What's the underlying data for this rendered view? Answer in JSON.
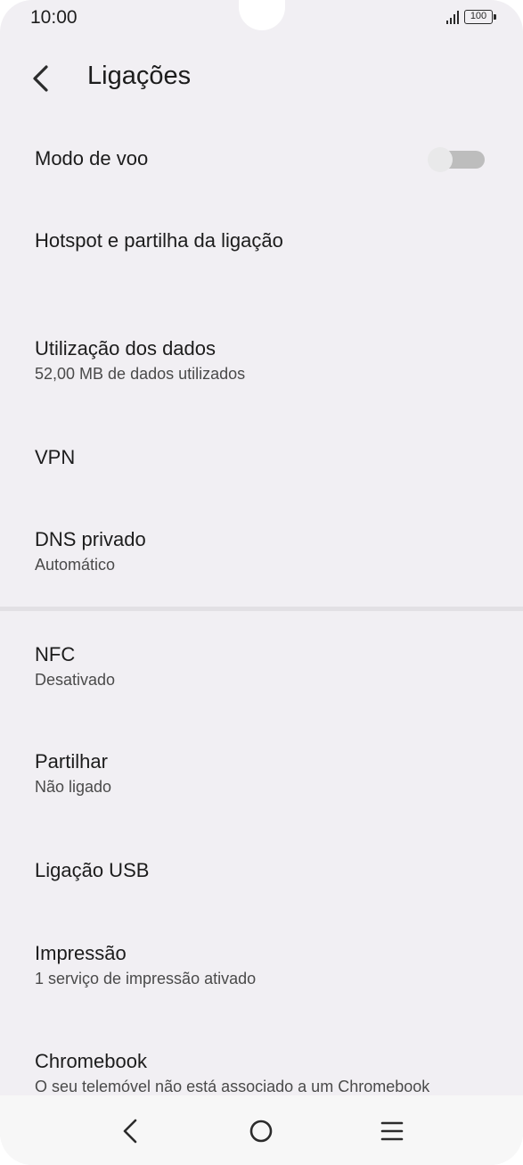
{
  "status_bar": {
    "time": "10:00",
    "battery": "100",
    "icons": [
      "signal-icon",
      "battery-icon"
    ]
  },
  "header": {
    "title": "Ligações",
    "back_icon": "back-arrow-icon"
  },
  "items": [
    {
      "title": "Modo de voo",
      "toggle": false
    },
    {
      "title": "Hotspot e partilha da ligação"
    },
    {
      "title": "Utilização dos dados",
      "subtitle": "52,00 MB de dados utilizados"
    },
    {
      "title": "VPN"
    },
    {
      "title": "DNS privado",
      "subtitle": "Automático"
    },
    {
      "title": "NFC",
      "subtitle": "Desativado"
    },
    {
      "title": "Partilhar",
      "subtitle": "Não ligado"
    },
    {
      "title": "Ligação USB"
    },
    {
      "title": "Impressão",
      "subtitle": "1 serviço de impressão ativado"
    },
    {
      "title": "Chromebook",
      "subtitle": "O seu telemóvel não está associado a um Chromebook"
    }
  ],
  "nav_bar": {
    "icons": [
      "nav-back-icon",
      "nav-home-icon",
      "nav-menu-icon"
    ]
  },
  "colors": {
    "background": "#f1eff3",
    "text_primary": "#1c1c1c",
    "text_secondary": "#4a4a4a",
    "toggle_track_off": "#bdbdbd",
    "toggle_thumb_off": "#e9e9ea",
    "nav_bar": "#f7f7f7"
  }
}
